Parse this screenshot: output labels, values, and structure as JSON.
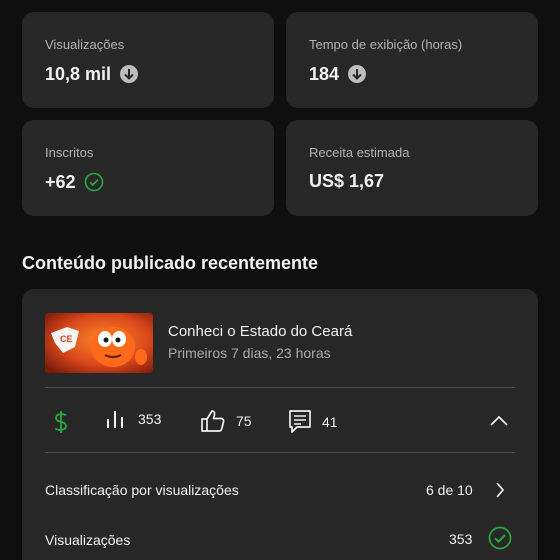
{
  "stats": {
    "views": {
      "label": "Visualizações",
      "value": "10,8 mil",
      "trend_icon": "arrow-down-circle-icon"
    },
    "watch_time": {
      "label": "Tempo de exibição (horas)",
      "value": "184",
      "trend_icon": "arrow-down-circle-icon"
    },
    "subscribers": {
      "label": "Inscritos",
      "value": "+62",
      "trend_icon": "check-circle-icon"
    },
    "revenue": {
      "label": "Receita estimada",
      "value": "US$ 1,67"
    }
  },
  "recent": {
    "title": "Conteúdo publicado recentemente",
    "video": {
      "title": "Conheci o Estado do Ceará",
      "subtitle": "Primeiros 7 dias, 23 horas",
      "thumb_badge": "CE"
    },
    "metrics": {
      "views": "353",
      "likes": "75",
      "comments": "41"
    },
    "ranking": {
      "label": "Classificação por visualizações",
      "value": "6 de 10"
    },
    "views_row": {
      "label": "Visualizações",
      "value": "353"
    }
  },
  "colors": {
    "background": "#0f0f0f",
    "card": "#272727",
    "positive": "#2ba640",
    "muted": "#aaaaaa"
  }
}
